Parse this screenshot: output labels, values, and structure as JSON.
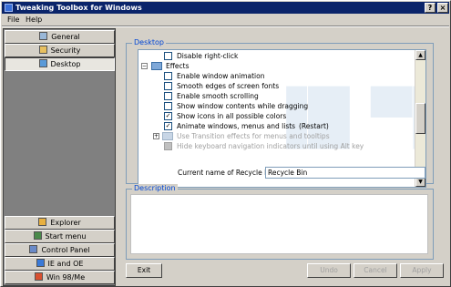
{
  "window": {
    "title": "Tweaking Toolbox for Windows",
    "help_button": "?",
    "close_button": "×"
  },
  "menu": {
    "items": [
      "File",
      "Help"
    ]
  },
  "sidebar": {
    "top_categories": [
      {
        "label": "General",
        "icon": "general-icon",
        "active": false
      },
      {
        "label": "Security",
        "icon": "security-icon",
        "active": false
      },
      {
        "label": "Desktop",
        "icon": "desktop-icon",
        "active": true
      }
    ],
    "bottom_categories": [
      {
        "label": "Explorer",
        "icon": "explorer-icon"
      },
      {
        "label": "Start menu",
        "icon": "start-menu-icon"
      },
      {
        "label": "Control Panel",
        "icon": "control-panel-icon"
      },
      {
        "label": "IE and OE",
        "icon": "ie-icon"
      },
      {
        "label": "Win 98/Me",
        "icon": "windows-icon"
      }
    ]
  },
  "desktop_group": {
    "legend": "Desktop",
    "tree": [
      {
        "label": "Disable right-click",
        "checked": false,
        "enabled": true,
        "type": "check"
      },
      {
        "label": "Effects",
        "type": "folder",
        "expanded": true,
        "enabled": true
      },
      {
        "label": "Enable window animation",
        "checked": false,
        "enabled": true,
        "type": "check"
      },
      {
        "label": "Smooth edges of screen fonts",
        "checked": false,
        "enabled": true,
        "type": "check"
      },
      {
        "label": "Enable smooth scrolling",
        "checked": false,
        "enabled": true,
        "type": "check"
      },
      {
        "label": "Show window contents while dragging",
        "checked": false,
        "enabled": true,
        "type": "check"
      },
      {
        "label": "Show icons in all possible colors",
        "checked": true,
        "enabled": true,
        "type": "check"
      },
      {
        "label": "Animate windows, menus and lists",
        "note": "(Restart)",
        "checked": true,
        "enabled": true,
        "type": "check"
      },
      {
        "label": "Use Transition effects for menus and tooltips",
        "type": "folder",
        "expanded": false,
        "enabled": false
      },
      {
        "label": "Hide keyboard navigation indicators until using Alt key",
        "checked": true,
        "enabled": false,
        "type": "check"
      }
    ],
    "recycle_bin_label": "Current name of Recycle Bin",
    "recycle_bin_value": "Recycle Bin"
  },
  "description": {
    "legend": "Description"
  },
  "buttons": {
    "exit": "Exit",
    "undo": "Undo",
    "cancel": "Cancel",
    "apply": "Apply"
  },
  "colors": {
    "titlebar": "#0a246a",
    "face": "#d4d0c8",
    "legend_text": "#0046d5",
    "sidebar_bg": "#808080"
  }
}
